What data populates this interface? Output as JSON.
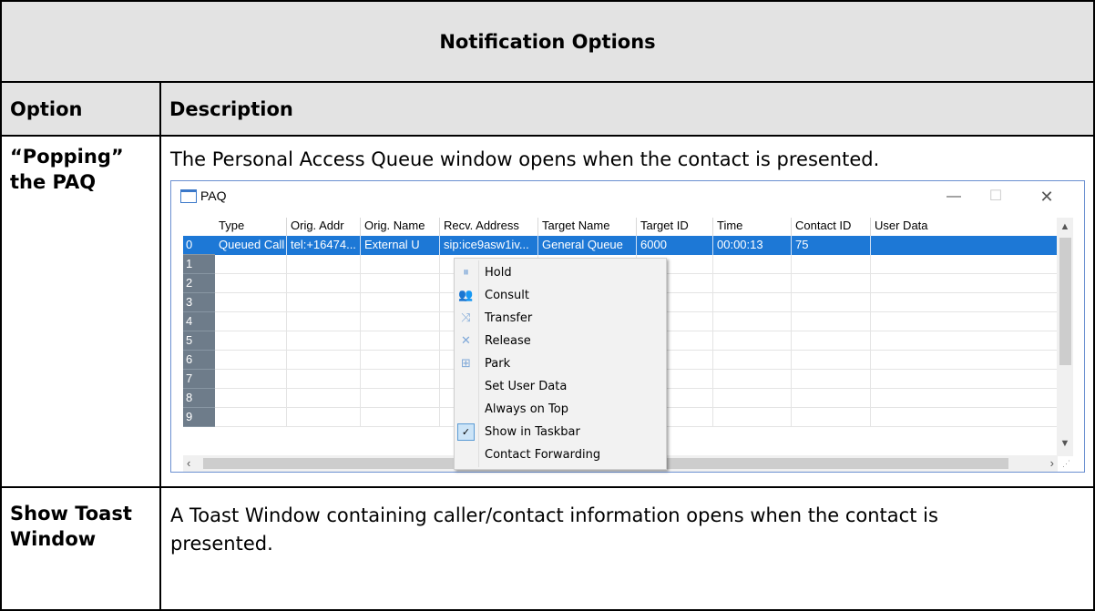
{
  "document": {
    "title": "Notification Options",
    "columns": [
      "Option",
      "Description"
    ],
    "rows": [
      {
        "option": "“Popping” the PAQ",
        "description": "The Personal Access Queue window opens when the contact is presented."
      },
      {
        "option": "Show Toast Window",
        "description": "A Toast Window containing caller/contact information opens when the contact is presented."
      }
    ]
  },
  "paq": {
    "title": "PAQ",
    "window_buttons": {
      "minimize": "—",
      "maximize": "☐",
      "close": "✕"
    },
    "columns": [
      "Type",
      "Orig. Addr",
      "Orig. Name",
      "Recv. Address",
      "Target Name",
      "Target ID",
      "Time",
      "Contact ID",
      "User Data"
    ],
    "rows": [
      {
        "num": "0",
        "cells": [
          "Queued Call",
          "tel:+16474...",
          "External U",
          "sip:ice9asw1iv...",
          "General Queue",
          "6000",
          "00:00:13",
          "75",
          ""
        ]
      },
      {
        "num": "1",
        "cells": [
          "",
          "",
          "",
          "",
          "",
          "",
          "",
          "",
          ""
        ]
      },
      {
        "num": "2",
        "cells": [
          "",
          "",
          "",
          "",
          "",
          "",
          "",
          "",
          ""
        ]
      },
      {
        "num": "3",
        "cells": [
          "",
          "",
          "",
          "",
          "",
          "",
          "",
          "",
          ""
        ]
      },
      {
        "num": "4",
        "cells": [
          "",
          "",
          "",
          "",
          "",
          "",
          "",
          "",
          ""
        ]
      },
      {
        "num": "5",
        "cells": [
          "",
          "",
          "",
          "",
          "",
          "",
          "",
          "",
          ""
        ]
      },
      {
        "num": "6",
        "cells": [
          "",
          "",
          "",
          "",
          "",
          "",
          "",
          "",
          ""
        ]
      },
      {
        "num": "7",
        "cells": [
          "",
          "",
          "",
          "",
          "",
          "",
          "",
          "",
          ""
        ]
      },
      {
        "num": "8",
        "cells": [
          "",
          "",
          "",
          "",
          "",
          "",
          "",
          "",
          ""
        ]
      },
      {
        "num": "9",
        "cells": [
          "",
          "",
          "",
          "",
          "",
          "",
          "",
          "",
          ""
        ]
      }
    ],
    "scroll": {
      "up": "▲",
      "down": "▼",
      "left": "‹",
      "right": "›",
      "grip": "⋰"
    },
    "context_menu": [
      {
        "label": "Hold",
        "icon": "pause-icon",
        "glyph": "⏸"
      },
      {
        "label": "Consult",
        "icon": "consult-icon",
        "glyph": "👥"
      },
      {
        "label": "Transfer",
        "icon": "transfer-icon",
        "glyph": "⤨"
      },
      {
        "label": "Release",
        "icon": "release-icon",
        "glyph": "✕"
      },
      {
        "label": "Park",
        "icon": "park-icon",
        "glyph": "⊞"
      },
      {
        "label": "Set User Data",
        "icon": "",
        "glyph": ""
      },
      {
        "label": "Always on Top",
        "icon": "",
        "glyph": ""
      },
      {
        "label": "Show in Taskbar",
        "icon": "check-icon",
        "glyph": "✓",
        "checked": true
      },
      {
        "label": "Contact Forwarding",
        "icon": "",
        "glyph": ""
      }
    ]
  },
  "colors": {
    "selection": "#1d78d6",
    "row_header": "#6e7c8a",
    "table_header_bg": "#e3e3e3"
  }
}
